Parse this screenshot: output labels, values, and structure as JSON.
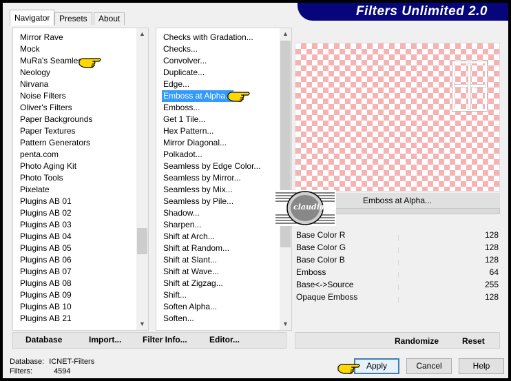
{
  "title": "Filters Unlimited 2.0",
  "tabs": [
    "Navigator",
    "Presets",
    "About"
  ],
  "categories": [
    "Mirror Rave",
    "Mock",
    "MuRa's Seamless",
    "Neology",
    "Nirvana",
    "Noise Filters",
    "Oliver's Filters",
    "Paper Backgrounds",
    "Paper Textures",
    "Pattern Generators",
    "penta.com",
    "Photo Aging Kit",
    "Photo Tools",
    "Pixelate",
    "Plugins AB 01",
    "Plugins AB 02",
    "Plugins AB 03",
    "Plugins AB 04",
    "Plugins AB 05",
    "Plugins AB 06",
    "Plugins AB 07",
    "Plugins AB 08",
    "Plugins AB 09",
    "Plugins AB 10",
    "Plugins AB 21"
  ],
  "filters": [
    "Checks with Gradation...",
    "Checks...",
    "Convolver...",
    "Duplicate...",
    "Edge...",
    "Emboss at Alpha...",
    "Emboss...",
    "Get 1 Tile...",
    "Hex Pattern...",
    "Mirror Diagonal...",
    "Polkadot...",
    "Seamless by Edge Color...",
    "Seamless by Mirror...",
    "Seamless by Mix...",
    "Seamless by Pile...",
    "Shadow...",
    "Sharpen...",
    "Shift at Arch...",
    "Shift at Random...",
    "Shift at Slant...",
    "Shift at Wave...",
    "Shift at Zigzag...",
    "Shift...",
    "Soften Alpha...",
    "Soften..."
  ],
  "selected_filter": "Emboss at Alpha...",
  "left_buttons": [
    "Database",
    "Import...",
    "Filter Info...",
    "Editor..."
  ],
  "parameters": [
    {
      "label": "Base Color R",
      "value": "128"
    },
    {
      "label": "Base Color G",
      "value": "128"
    },
    {
      "label": "Base Color B",
      "value": "128"
    },
    {
      "label": "Emboss",
      "value": "64"
    },
    {
      "label": "Base<->Source",
      "value": "255"
    },
    {
      "label": "Opaque Emboss",
      "value": "128"
    }
  ],
  "right_buttons": {
    "randomize": "Randomize",
    "reset": "Reset"
  },
  "status": {
    "database_label": "Database:",
    "database_value": "ICNET-Filters",
    "filters_label": "Filters:",
    "filters_value": "4594"
  },
  "dialog_buttons": {
    "apply": "Apply",
    "cancel": "Cancel",
    "help": "Help"
  },
  "stamp_text": "claudia",
  "colors": {
    "banner": "#06067a",
    "selection": "#3399ff",
    "checker": "#f6b3b3",
    "pointer": "#ffd800"
  }
}
